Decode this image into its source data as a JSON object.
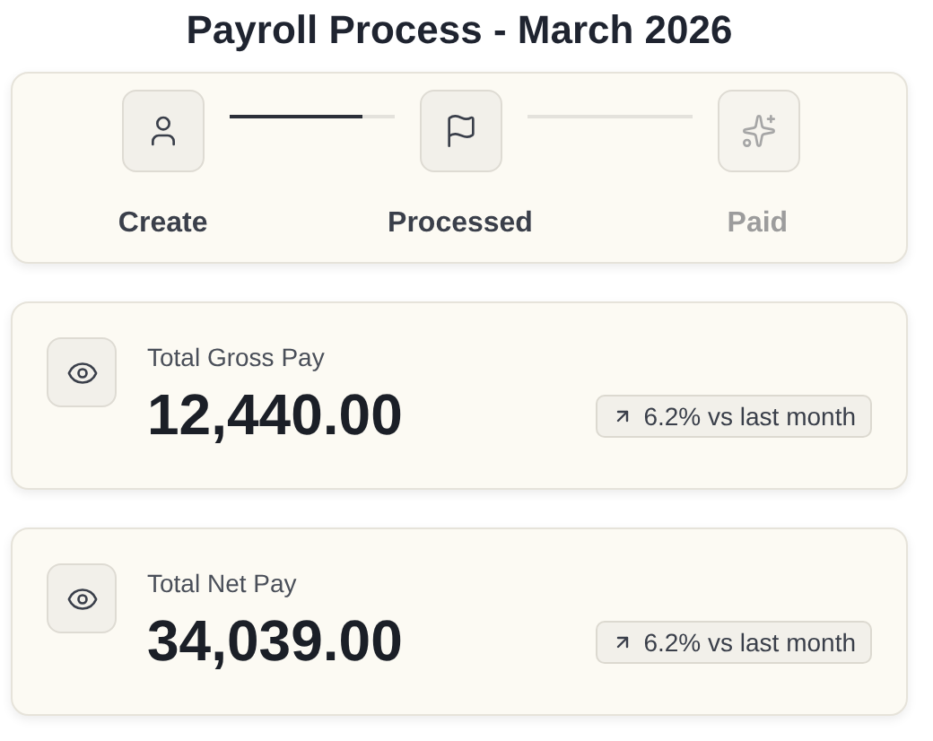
{
  "title": "Payroll Process - March 2026",
  "steps": [
    {
      "label": "Create",
      "disabled": false
    },
    {
      "label": "Processed",
      "disabled": false
    },
    {
      "label": "Paid",
      "disabled": true
    }
  ],
  "connectors": [
    {
      "level": 0.8
    }
  ],
  "cards": [
    {
      "label": "Total Gross Pay",
      "value": "12,440.00",
      "change": "6.2% vs last month"
    },
    {
      "label": "Total Net Pay",
      "value": "34,039.00",
      "change": "6.2% vs last month"
    }
  ]
}
